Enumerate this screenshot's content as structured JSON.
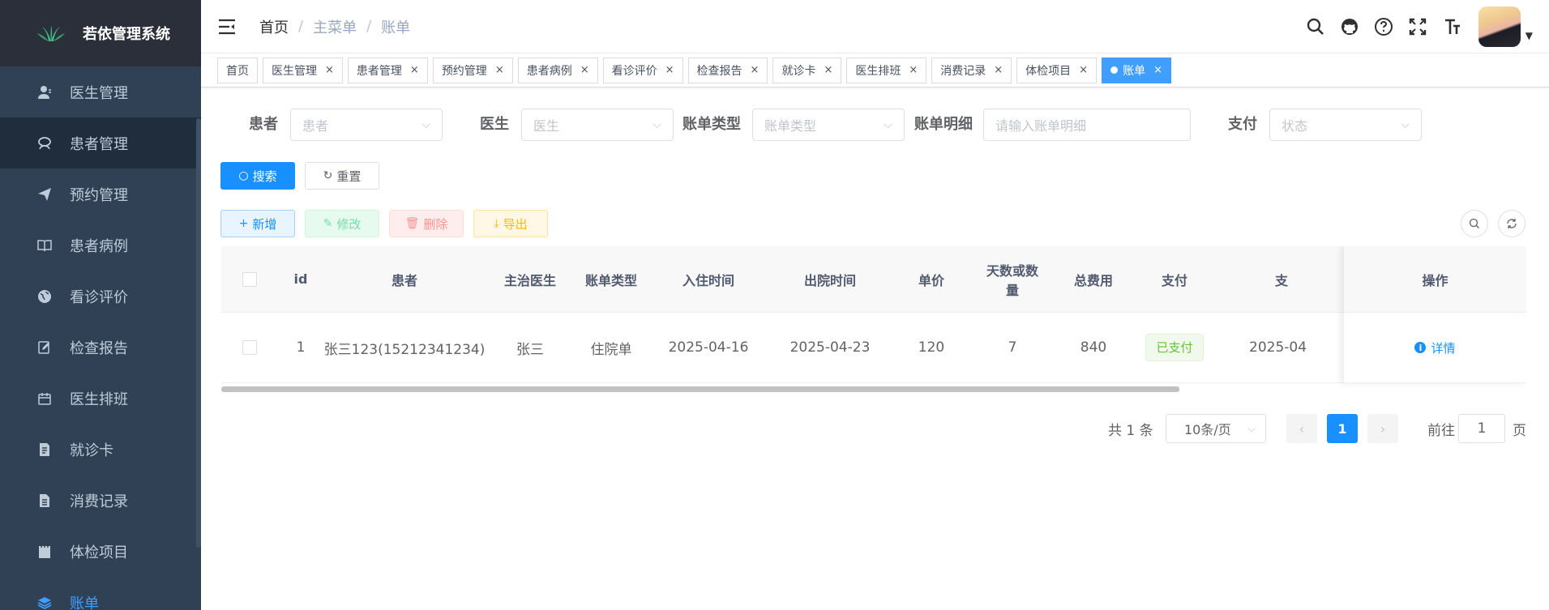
{
  "app": {
    "title": "若依管理系统"
  },
  "sidebar": {
    "items": [
      {
        "label": "医生管理",
        "icon": "user-icon"
      },
      {
        "label": "患者管理",
        "icon": "peoples-icon"
      },
      {
        "label": "预约管理",
        "icon": "send-icon"
      },
      {
        "label": "患者病例",
        "icon": "book-icon"
      },
      {
        "label": "看诊评价",
        "icon": "globe-icon"
      },
      {
        "label": "检查报告",
        "icon": "edit-doc-icon"
      },
      {
        "label": "医生排班",
        "icon": "calendar-icon"
      },
      {
        "label": "就诊卡",
        "icon": "card-icon"
      },
      {
        "label": "消费记录",
        "icon": "doc-icon"
      },
      {
        "label": "体检项目",
        "icon": "clipboard-icon"
      },
      {
        "label": "账单",
        "icon": "layers-icon"
      }
    ]
  },
  "breadcrumb": {
    "home": "首页",
    "sep": "/",
    "parent": "主菜单",
    "current": "账单"
  },
  "tags": [
    {
      "label": "首页",
      "closable": false
    },
    {
      "label": "医生管理",
      "closable": true
    },
    {
      "label": "患者管理",
      "closable": true
    },
    {
      "label": "预约管理",
      "closable": true
    },
    {
      "label": "患者病例",
      "closable": true
    },
    {
      "label": "看诊评价",
      "closable": true
    },
    {
      "label": "检查报告",
      "closable": true
    },
    {
      "label": "就诊卡",
      "closable": true
    },
    {
      "label": "医生排班",
      "closable": true
    },
    {
      "label": "消费记录",
      "closable": true
    },
    {
      "label": "体检项目",
      "closable": true
    },
    {
      "label": "账单",
      "closable": true,
      "active": true
    }
  ],
  "tag_close": "×",
  "filters": {
    "patient": {
      "label": "患者",
      "placeholder": "患者"
    },
    "doctor": {
      "label": "医生",
      "placeholder": "医生"
    },
    "bill_type": {
      "label": "账单类型",
      "placeholder": "账单类型"
    },
    "bill_detail": {
      "label": "账单明细",
      "placeholder": "请输入账单明细"
    },
    "payment": {
      "label": "支付",
      "placeholder": "状态"
    }
  },
  "buttons": {
    "search": "搜索",
    "reset": "重置",
    "add": "新增",
    "edit": "修改",
    "delete": "删除",
    "export": "导出"
  },
  "table": {
    "headers": {
      "id": "id",
      "patient": "患者",
      "doctor": "主治医生",
      "bill_type": "账单类型",
      "admit": "入住时间",
      "discharge": "出院时间",
      "price": "单价",
      "days1": "天数或数",
      "days2": "量",
      "total": "总费用",
      "payment": "支付",
      "pay_time": "支",
      "actions": "操作"
    },
    "rows": [
      {
        "id": "1",
        "patient": "张三123(15212341234)",
        "doctor": "张三",
        "bill_type": "住院单",
        "admit": "2025-04-16",
        "discharge": "2025-04-23",
        "price": "120",
        "days": "7",
        "total": "840",
        "payment": "已支付",
        "pay_time": "2025-04",
        "action": "详情"
      }
    ]
  },
  "pagination": {
    "total_text": "共 1 条",
    "page_size": "10条/页",
    "current_page": "1",
    "goto_prefix": "前往",
    "goto_value": "1",
    "goto_suffix": "页"
  },
  "colors": {
    "sidebar_bg": "#304156",
    "primary": "#1890ff",
    "success": "#67c23a"
  }
}
